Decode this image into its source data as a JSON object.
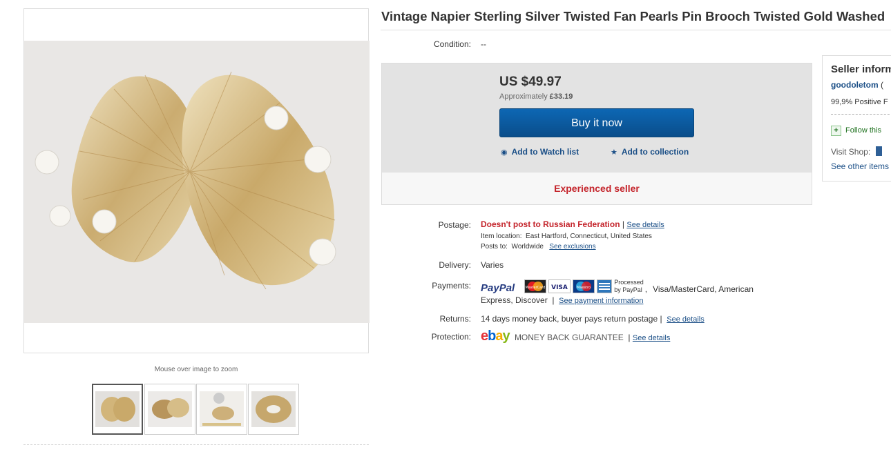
{
  "title": "Vintage Napier Sterling Silver Twisted Fan Pearls Pin Brooch Twisted Gold Washed",
  "gallery": {
    "zoom_hint": "Mouse over image to zoom"
  },
  "condition": {
    "label": "Condition:",
    "value": "--"
  },
  "price": {
    "amount": "US $49.97",
    "approx_prefix": "Approximately",
    "approx_value": "£33.19",
    "buy_label": "Buy it now",
    "watch_label": "Add to Watch list",
    "collection_label": "Add to collection",
    "experienced": "Experienced seller"
  },
  "postage": {
    "label": "Postage:",
    "value": "Doesn't post to Russian Federation",
    "sep": "|",
    "details_link": "See details",
    "location_label": "Item location:",
    "location": "East Hartford, Connecticut, United States",
    "posts_label": "Posts to:",
    "posts": "Worldwide",
    "exclusions_link": "See exclusions"
  },
  "delivery": {
    "label": "Delivery:",
    "value": "Varies"
  },
  "payments": {
    "label": "Payments:",
    "paypal": "PayPal",
    "processed_line1": "Processed",
    "processed_line2": "by PayPal",
    "comma": ",",
    "methods_line1": "Visa/MasterCard, American",
    "methods_line2": "Express, Discover",
    "sep": "|",
    "info_link": "See payment information",
    "card_mastercard": "MasterCard",
    "card_visa": "VISA",
    "card_maestro": "Maestro"
  },
  "returns": {
    "label": "Returns:",
    "value": "14 days money back, buyer pays return postage",
    "sep": "|",
    "details_link": "See details"
  },
  "protection": {
    "label": "Protection:",
    "ebay_e": "e",
    "ebay_b": "b",
    "ebay_a": "a",
    "ebay_y": "y",
    "guarantee": "MONEY BACK GUARANTEE",
    "sep": "|",
    "details_link": "See details"
  },
  "seller": {
    "heading": "Seller inform",
    "name": "goodoletom",
    "paren": "(",
    "feedback": "99,9% Positive F",
    "follow": "Follow this",
    "visit_shop": "Visit Shop:",
    "other_items": "See other items"
  },
  "colors": {
    "link": "#1b4f87",
    "alert_red": "#c4242b",
    "button_blue": "#0a4d8a"
  }
}
